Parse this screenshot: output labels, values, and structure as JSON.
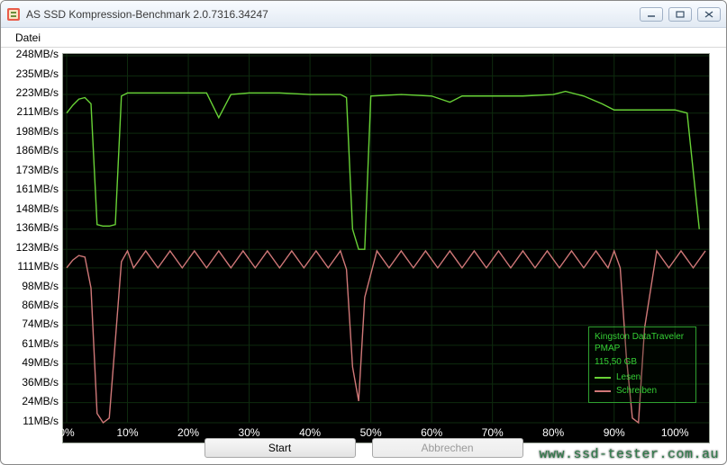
{
  "window": {
    "title": "AS SSD Kompression-Benchmark 2.0.7316.34247"
  },
  "menu": {
    "file": "Datei"
  },
  "buttons": {
    "start": "Start",
    "cancel": "Abbrechen"
  },
  "legend": {
    "device": "Kingston DataTraveler PMAP",
    "capacity": "115,50 GB",
    "read": "Lesen",
    "write": "Schreiben",
    "read_color": "#68d236",
    "write_color": "#d07878"
  },
  "watermark": "www.ssd-tester.com.au",
  "chart_data": {
    "type": "line",
    "xlabel": "",
    "ylabel": "",
    "x_unit": "%",
    "y_unit": "MB/s",
    "xlim": [
      0,
      105
    ],
    "ylim": [
      11,
      248
    ],
    "x_ticks": [
      0,
      10,
      20,
      30,
      40,
      50,
      60,
      70,
      80,
      90,
      100
    ],
    "y_ticks": [
      248,
      235,
      223,
      211,
      198,
      186,
      173,
      161,
      148,
      136,
      123,
      111,
      98,
      86,
      74,
      61,
      49,
      36,
      24,
      11
    ],
    "series": [
      {
        "name": "Lesen",
        "color": "#68d236",
        "x": [
          0,
          1,
          2,
          3,
          4,
          5,
          6,
          7,
          8,
          9,
          10,
          15,
          20,
          23,
          25,
          27,
          30,
          35,
          40,
          45,
          46,
          47,
          48,
          49,
          50,
          55,
          60,
          63,
          65,
          70,
          75,
          80,
          82,
          85,
          88,
          90,
          95,
          100,
          102,
          104
        ],
        "values": [
          211,
          216,
          220,
          221,
          217,
          139,
          138,
          138,
          139,
          222,
          224,
          224,
          224,
          224,
          208,
          223,
          224,
          224,
          223,
          223,
          221,
          136,
          123,
          123,
          222,
          223,
          222,
          218,
          222,
          222,
          222,
          223,
          225,
          222,
          217,
          213,
          213,
          213,
          211,
          136
        ]
      },
      {
        "name": "Schreiben",
        "color": "#d07878",
        "x": [
          0,
          1,
          2,
          3,
          4,
          5,
          6,
          7,
          8,
          9,
          10,
          11,
          13,
          15,
          17,
          19,
          21,
          23,
          25,
          27,
          29,
          31,
          33,
          35,
          37,
          39,
          41,
          43,
          45,
          46,
          47,
          48,
          49,
          51,
          53,
          55,
          57,
          59,
          61,
          63,
          65,
          67,
          69,
          71,
          73,
          75,
          77,
          79,
          81,
          83,
          85,
          87,
          89,
          90,
          91,
          92,
          93,
          94,
          95,
          97,
          99,
          101,
          103,
          105
        ],
        "values": [
          111,
          116,
          119,
          118,
          98,
          17,
          11,
          14,
          64,
          115,
          122,
          111,
          122,
          111,
          122,
          111,
          122,
          111,
          122,
          111,
          122,
          111,
          122,
          111,
          122,
          111,
          122,
          111,
          122,
          110,
          47,
          25,
          92,
          122,
          111,
          122,
          111,
          122,
          111,
          122,
          111,
          122,
          111,
          122,
          111,
          122,
          111,
          122,
          111,
          122,
          111,
          122,
          111,
          122,
          111,
          54,
          14,
          11,
          72,
          122,
          111,
          122,
          111,
          122
        ]
      }
    ]
  }
}
